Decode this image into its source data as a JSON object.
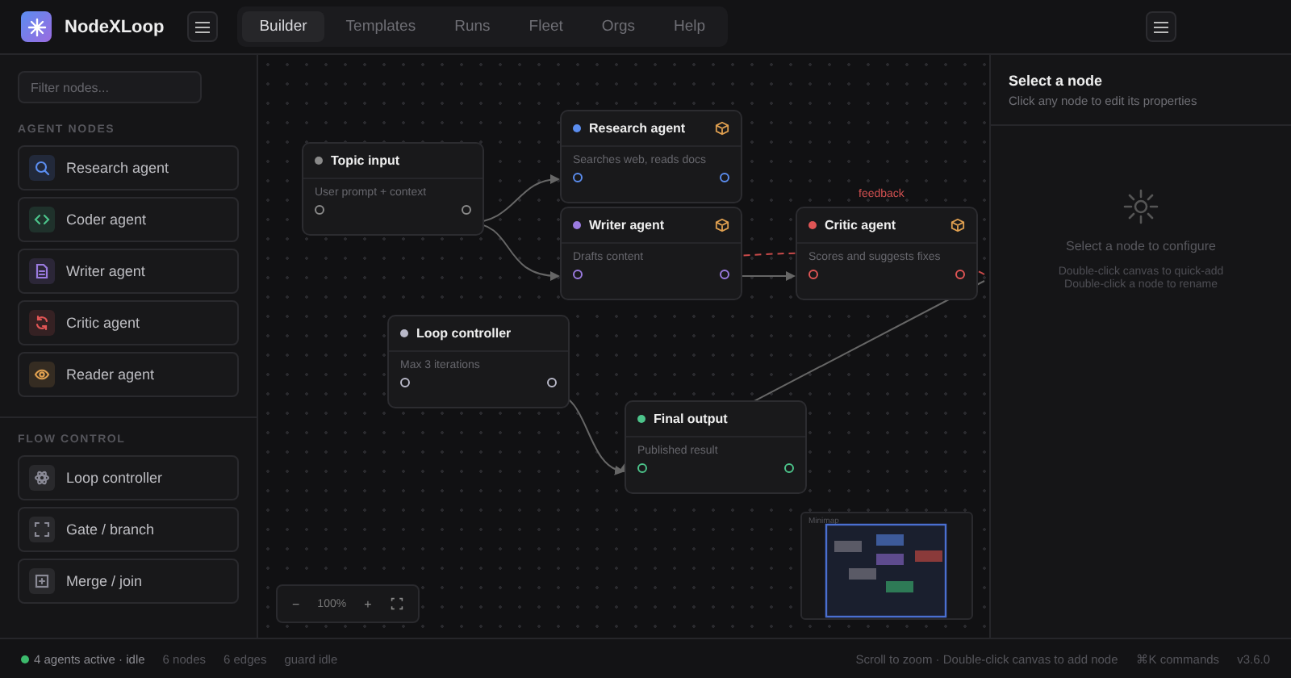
{
  "app": {
    "name": "NodeXLoop"
  },
  "tabs": [
    {
      "label": "Builder",
      "selected": true
    },
    {
      "label": "Templates",
      "selected": false
    },
    {
      "label": "Runs",
      "selected": false
    },
    {
      "label": "Fleet",
      "selected": false
    },
    {
      "label": "Orgs",
      "selected": false
    },
    {
      "label": "Help",
      "selected": false
    }
  ],
  "sidebar": {
    "filter": {
      "placeholder": "Filter nodes..."
    },
    "sections": [
      {
        "title": "AGENT NODES",
        "items": [
          {
            "label": "Research agent",
            "color": "#5b8def"
          },
          {
            "label": "Coder agent",
            "color": "#4cc38a"
          },
          {
            "label": "Writer agent",
            "color": "#9b7be0"
          },
          {
            "label": "Critic agent",
            "color": "#e05555"
          },
          {
            "label": "Reader agent",
            "color": "#e0a050"
          }
        ]
      },
      {
        "title": "FLOW CONTROL",
        "items": [
          {
            "label": "Loop controller",
            "color": "#8a8a96"
          },
          {
            "label": "Gate / branch",
            "color": "#8a8a96"
          },
          {
            "label": "Merge / join",
            "color": "#8a8a96"
          }
        ]
      }
    ]
  },
  "canvas": {
    "nodes": [
      {
        "title": "Topic input",
        "description": "User prompt + context",
        "color": "#8a8a8a",
        "kind": "io"
      },
      {
        "title": "Research agent",
        "description": "Searches web, reads docs",
        "color": "#5b8def",
        "kind": "agent"
      },
      {
        "title": "Writer agent",
        "description": "Drafts content",
        "color": "#9b7be0",
        "kind": "agent"
      },
      {
        "title": "Critic agent",
        "description": "Scores and suggests fixes",
        "color": "#e05555",
        "kind": "agent"
      },
      {
        "title": "Loop controller",
        "description": "Max 3 iterations",
        "color": "#b8b8c8",
        "kind": "control"
      },
      {
        "title": "Final output",
        "description": "Published result",
        "color": "#4cc38a",
        "kind": "io"
      }
    ],
    "edge_label": "feedback",
    "zoom": {
      "minus": "−",
      "level": "100%",
      "plus": "+"
    },
    "minimap": {
      "label": "Minimap"
    }
  },
  "inspector": {
    "title": "Select a node",
    "subtitle": "Click any node to edit its properties",
    "empty_title": "Select a node to configure",
    "hints": [
      "Double-click canvas to quick-add",
      "Double-click a node to rename"
    ]
  },
  "status_bar": {
    "left": [
      "4 agents active · idle",
      "6 nodes",
      "6 edges",
      "guard idle"
    ],
    "right": [
      "Scroll to zoom · Double-click canvas to add node",
      "⌘K commands",
      "v3.6.0"
    ]
  }
}
